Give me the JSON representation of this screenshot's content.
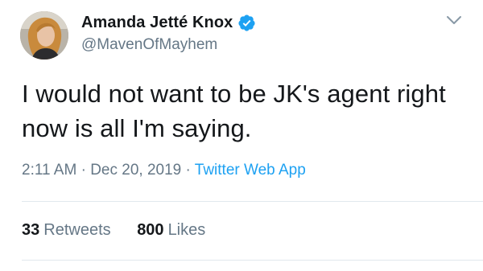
{
  "author": {
    "display_name": "Amanda Jetté Knox",
    "handle": "@MavenOfMayhem",
    "verified": true,
    "verified_icon": "verified-badge-icon",
    "avatar_icon": "avatar"
  },
  "tweet": {
    "text": "I would not want to be JK's agent right now is all I'm saying."
  },
  "meta": {
    "time": "2:11 AM",
    "separator": "·",
    "date": "Dec 20, 2019",
    "source": "Twitter Web App"
  },
  "stats": {
    "retweets_count": "33",
    "retweets_label": "Retweets",
    "likes_count": "800",
    "likes_label": "Likes"
  },
  "colors": {
    "text": "#14171a",
    "secondary": "#657786",
    "accent": "#1da1f2",
    "divider": "#e1e8ed"
  }
}
